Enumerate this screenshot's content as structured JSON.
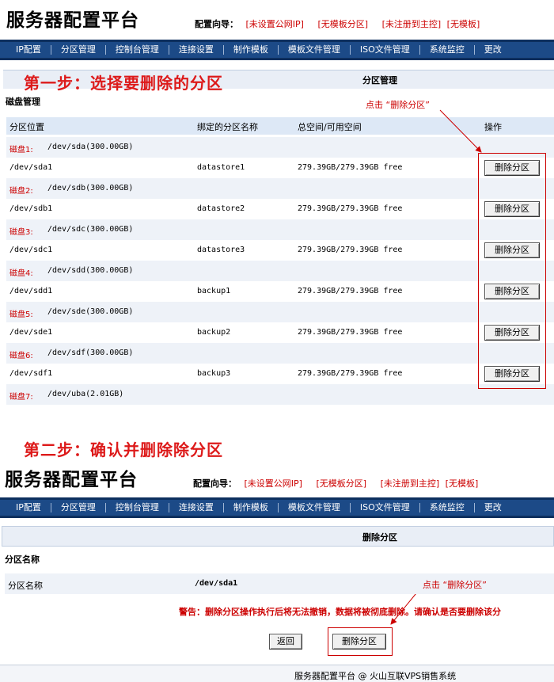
{
  "app_title": "服务器配置平台",
  "wizard": {
    "label": "配置向导：",
    "links": [
      "[未设置公网IP]",
      "[无模板分区]",
      "[未注册到主控]",
      "[无模板]"
    ]
  },
  "nav": [
    "IP配置",
    "分区管理",
    "控制台管理",
    "连接设置",
    "制作模板",
    "模板文件管理",
    "ISO文件管理",
    "系统监控",
    "更改"
  ],
  "step1": {
    "title": "第一步：选择要删除的分区",
    "panel_title": "分区管理",
    "section": "磁盘管理",
    "annotation": "点击 “删除分区”",
    "headers": [
      "分区位置",
      "绑定的分区名称",
      "总空间/可用空间",
      "操作"
    ],
    "disks": [
      {
        "label": "磁盘1:",
        "path": "/dev/sda(300.00GB)",
        "partition": "/dev/sda1",
        "name": "datastore1",
        "space": "279.39GB/279.39GB free"
      },
      {
        "label": "磁盘2:",
        "path": "/dev/sdb(300.00GB)",
        "partition": "/dev/sdb1",
        "name": "datastore2",
        "space": "279.39GB/279.39GB free"
      },
      {
        "label": "磁盘3:",
        "path": "/dev/sdc(300.00GB)",
        "partition": "/dev/sdc1",
        "name": "datastore3",
        "space": "279.39GB/279.39GB free"
      },
      {
        "label": "磁盘4:",
        "path": "/dev/sdd(300.00GB)",
        "partition": "/dev/sdd1",
        "name": "backup1",
        "space": "279.39GB/279.39GB free"
      },
      {
        "label": "磁盘5:",
        "path": "/dev/sde(300.00GB)",
        "partition": "/dev/sde1",
        "name": "backup2",
        "space": "279.39GB/279.39GB free"
      },
      {
        "label": "磁盘6:",
        "path": "/dev/sdf(300.00GB)",
        "partition": "/dev/sdf1",
        "name": "backup3",
        "space": "279.39GB/279.39GB free"
      }
    ],
    "last_disk": {
      "label": "磁盘7:",
      "path": "/dev/uba(2.01GB)"
    },
    "delete_button": "删除分区"
  },
  "step2": {
    "title": "第二步：确认并删除除分区",
    "panel_title": "删除分区",
    "section": "分区名称",
    "field_label": "分区名称",
    "field_value": "/dev/sda1",
    "annotation": "点击 “删除分区”",
    "warning": "警告：删除分区操作执行后将无法撤销，数据将被彻底删除。请确认是否要删除该分",
    "back_button": "返回",
    "delete_button": "删除分区"
  },
  "footer": "服务器配置平台 @ 火山互联VPS销售系统"
}
